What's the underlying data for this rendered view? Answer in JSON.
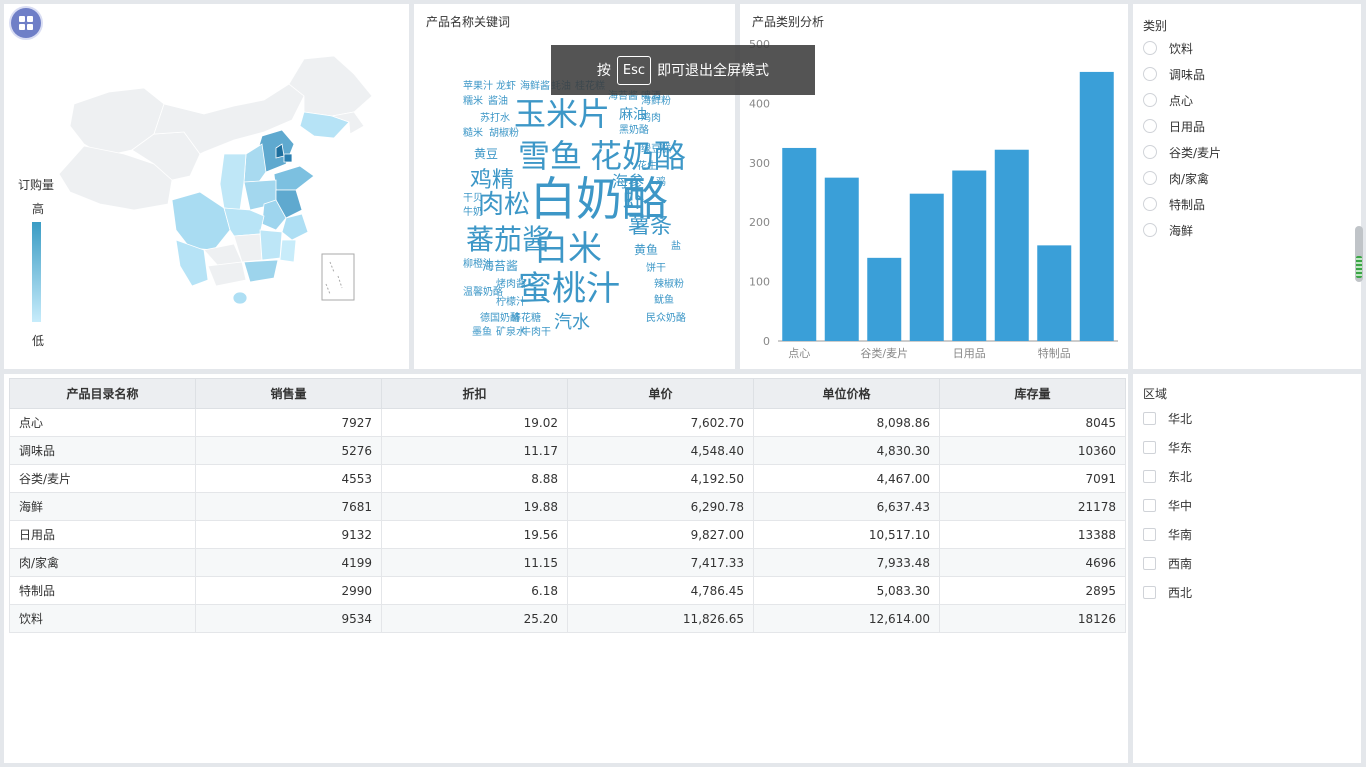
{
  "map_panel": {
    "legend_title": "订购量",
    "legend_high": "高",
    "legend_low": "低"
  },
  "cloud_panel": {
    "title": "产品名称关键词",
    "color": "#3d97c7",
    "words": [
      "苹果汁",
      "龙虾",
      "海鲜酱",
      "蚝油",
      "桂花糕",
      "海苔酱",
      "啤酒",
      "糯米",
      "酱油",
      "玉米片",
      "麻油",
      "海鲜粉",
      "苏打水",
      "黑奶酪",
      "鸡肉",
      "糙米",
      "胡椒粉",
      "绿豆糕",
      "黄豆",
      "雪鱼",
      "花奶酪",
      "花生",
      "鸡精",
      "海参",
      "鸡",
      "干贝",
      "肉松",
      "白奶酪",
      "虾",
      "牛奶",
      "薯条",
      "蕃茄酱",
      "白米",
      "黄鱼",
      "盐",
      "柳橙汁",
      "海苔酱",
      "饼干",
      "烤肉酱",
      "辣椒粉",
      "温馨奶酪",
      "蜜桃汁",
      "鱿鱼",
      "柠檬汁",
      "德国奶酪",
      "棒花糖",
      "民众奶酪",
      "汽水",
      "墨鱼",
      "矿泉水",
      "牛肉干"
    ]
  },
  "toast": {
    "prefix": "按",
    "key": "Esc",
    "suffix": "即可退出全屏模式"
  },
  "bar_panel": {
    "title": "产品类别分析",
    "bar_color": "#3a9fd8"
  },
  "chart_data": {
    "type": "bar",
    "categories": [
      "点心",
      "调味品",
      "谷类/麦片",
      "海鲜",
      "日用品",
      "肉/家禽",
      "特制品",
      "饮料"
    ],
    "x_tick_labels": [
      "点心",
      "谷类/麦片",
      "日用品",
      "特制品"
    ],
    "values": [
      325,
      275,
      140,
      248,
      287,
      322,
      161,
      453
    ],
    "ylim": [
      0,
      500
    ],
    "yticks": [
      0,
      100,
      200,
      300,
      400,
      500
    ],
    "grid": false
  },
  "category_filter": {
    "title": "类别",
    "options": [
      "饮料",
      "调味品",
      "点心",
      "日用品",
      "谷类/麦片",
      "肉/家禽",
      "特制品",
      "海鲜"
    ]
  },
  "table": {
    "columns": [
      "产品目录名称",
      "销售量",
      "折扣",
      "单价",
      "单位价格",
      "库存量"
    ],
    "rows": [
      [
        "点心",
        "7927",
        "19.02",
        "7,602.70",
        "8,098.86",
        "8045"
      ],
      [
        "调味品",
        "5276",
        "11.17",
        "4,548.40",
        "4,830.30",
        "10360"
      ],
      [
        "谷类/麦片",
        "4553",
        "8.88",
        "4,192.50",
        "4,467.00",
        "7091"
      ],
      [
        "海鲜",
        "7681",
        "19.88",
        "6,290.78",
        "6,637.43",
        "21178"
      ],
      [
        "日用品",
        "9132",
        "19.56",
        "9,827.00",
        "10,517.10",
        "13388"
      ],
      [
        "肉/家禽",
        "4199",
        "11.15",
        "7,417.33",
        "7,933.48",
        "4696"
      ],
      [
        "特制品",
        "2990",
        "6.18",
        "4,786.45",
        "5,083.30",
        "2895"
      ],
      [
        "饮料",
        "9534",
        "25.20",
        "11,826.65",
        "12,614.00",
        "18126"
      ]
    ]
  },
  "region_filter": {
    "title": "区域",
    "options": [
      "华北",
      "华东",
      "东北",
      "华中",
      "华南",
      "西南",
      "西北"
    ]
  },
  "icons": {
    "menu": "grid-menu-icon"
  }
}
